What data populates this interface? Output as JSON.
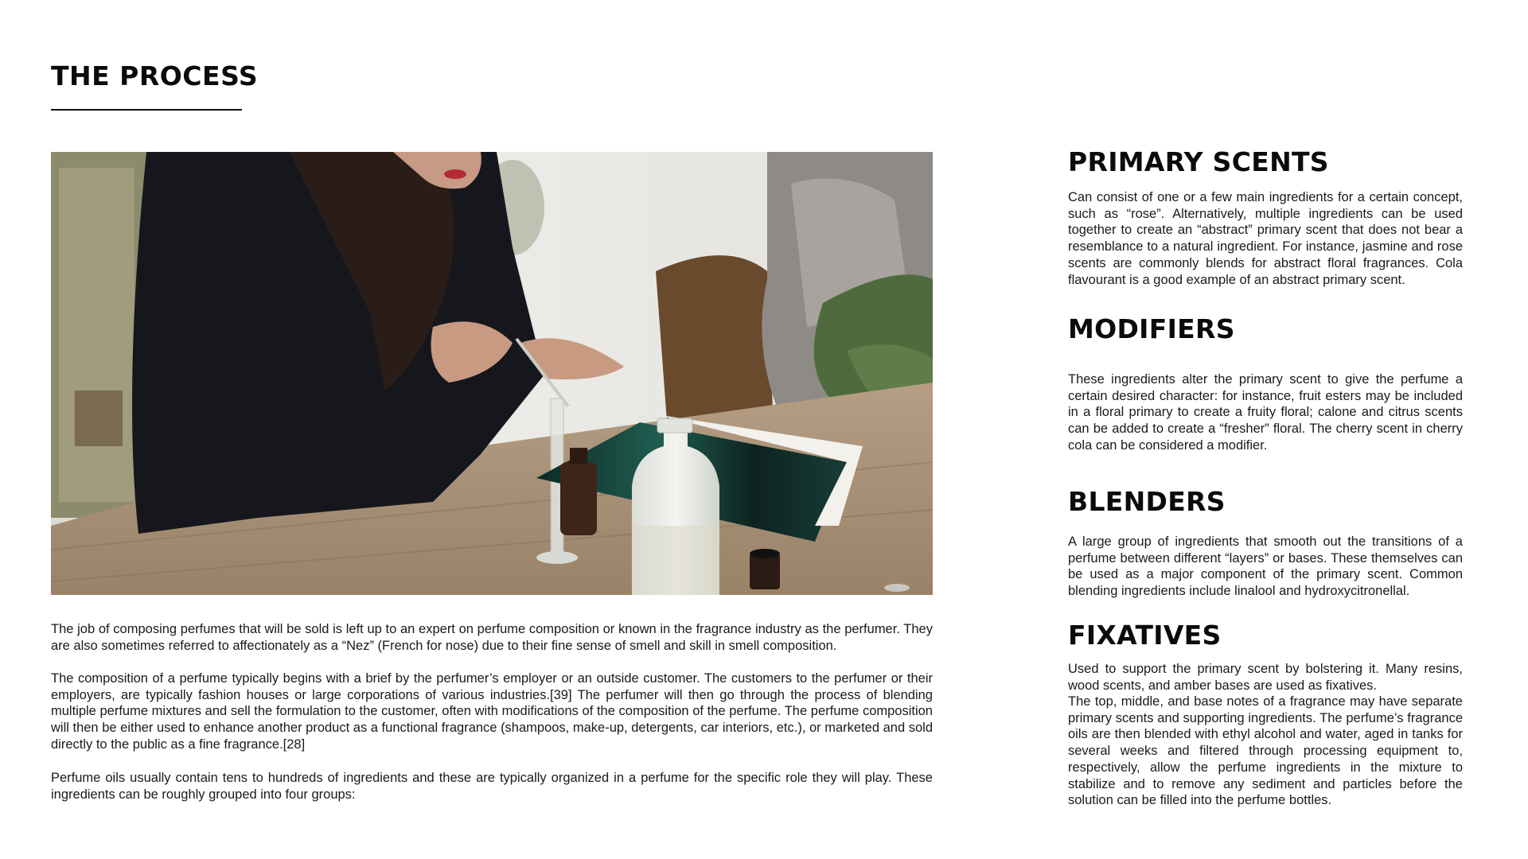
{
  "page": {
    "title": "THE PROCESS"
  },
  "photo": {
    "subject": "perfumer-composing-fragrance-photo"
  },
  "body": {
    "paragraphs": [
      "The job of composing perfumes that will be sold is left up to an expert on perfume composition or known in the fragrance industry as the perfumer. They are also sometimes referred to affectionately as a “Nez” (French for nose) due to their fine sense of smell and skill in smell composition.",
      "The composition of a perfume typically begins with a brief by the perfumer’s employer or an outside customer. The customers to the perfumer or their employers, are typically fashion houses or large corporations of various industries.[39] The perfumer will then go through the process of blending multiple perfume mixtures and sell the formulation to the customer, often with modifications of the composition of the perfume. The perfume composition will then be either used to enhance another product as a functional fragrance (shampoos, make-up, detergents, car interiors, etc.), or marketed and sold directly to the public as a fine fragrance.[28]",
      "Perfume oils usually contain tens to hundreds of ingredients and these are typically organized in a perfume for the specific role they will play. These ingredients can be roughly grouped into four groups:"
    ]
  },
  "sections": [
    {
      "heading": "PRIMARY SCENTS",
      "text": "Can consist of one or a few main ingredients for a certain concept, such as “rose”. Alternatively, multiple ingredients can be used together to create an “abstract” primary scent that does not bear a resemblance to a natural ingredient. For instance, jasmine and rose scents are commonly blends for abstract floral fragrances. Cola flavourant is a good example of an abstract primary scent."
    },
    {
      "heading": "MODIFIERS",
      "text": "These ingredients alter the primary scent to give the perfume a certain desired character: for instance, fruit esters may be included in a floral primary to create a fruity floral; calone and citrus scents can be added to create a “fresher” floral. The cherry scent in cherry cola can be considered a modifier."
    },
    {
      "heading": "BLENDERS",
      "text": "A large group of ingredients that smooth out the transitions of a perfume between different “layers” or bases. These themselves can be used as a major component of the primary scent. Common blending ingredients include linalool and hydroxycitronellal."
    },
    {
      "heading": "FIXATIVES",
      "text": "Used to support the primary scent by bolstering it. Many resins, wood scents, and amber bases are used as fixatives.",
      "text_extra": "The top, middle, and base notes of a fragrance may have separate primary scents and supporting ingredients. The perfume’s fragrance oils are then blended with ethyl alcohol and water, aged in tanks for several weeks and filtered through processing equipment to, respectively, allow the perfume ingredients in the mixture to stabilize and to remove any sediment and particles before the solution can be filled into the perfume bottles."
    }
  ]
}
